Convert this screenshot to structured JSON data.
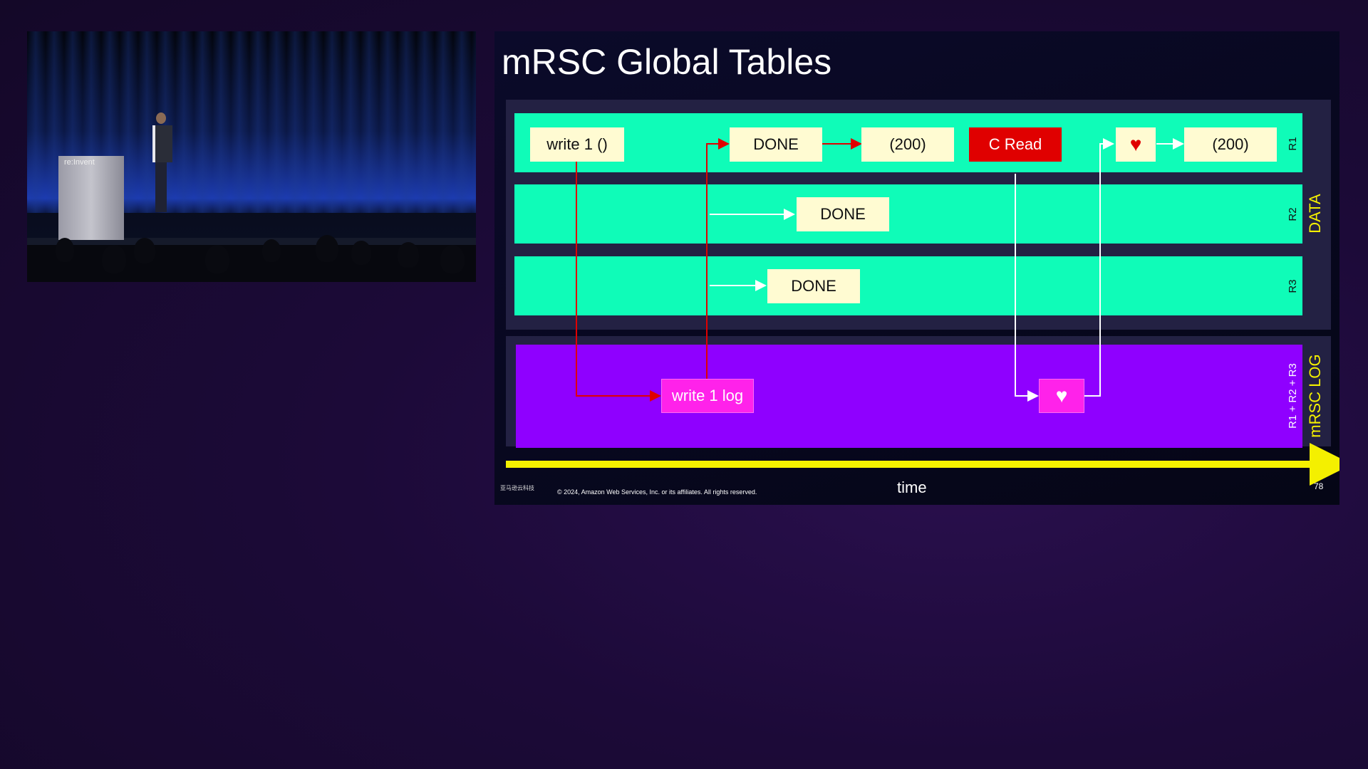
{
  "video": {
    "podium_logo": "re:Invent"
  },
  "slide": {
    "title": "mRSC Global Tables",
    "sections": {
      "data_label": "DATA",
      "log_label": "mRSC LOG"
    },
    "lanes": {
      "r1": "R1",
      "r2": "R2",
      "r3": "R3",
      "log": "R1 + R2 + R3"
    },
    "boxes": {
      "write1": "write 1 ()",
      "r1_done": "DONE",
      "r1_200_a": "(200)",
      "c_read": "C Read",
      "heart_r1": "♥",
      "r1_200_b": "(200)",
      "r2_done": "DONE",
      "r3_done": "DONE",
      "write1_log": "write 1 log",
      "heart_log": "♥"
    },
    "time_label": "time",
    "footer": {
      "logo_text": "亚马逊云科技",
      "copyright": "© 2024, Amazon Web Services, Inc. or its affiliates. All rights reserved.",
      "page_number": "78"
    }
  },
  "colors": {
    "data_lane": "#0ffcb8",
    "log_lane": "#8f00ff",
    "cream_box": "#fffbd2",
    "red_box": "#e00000",
    "magenta_box": "#ff22ea",
    "timeline": "#f4f000",
    "red_arrow": "#e00000",
    "white_arrow": "#ffffff"
  }
}
